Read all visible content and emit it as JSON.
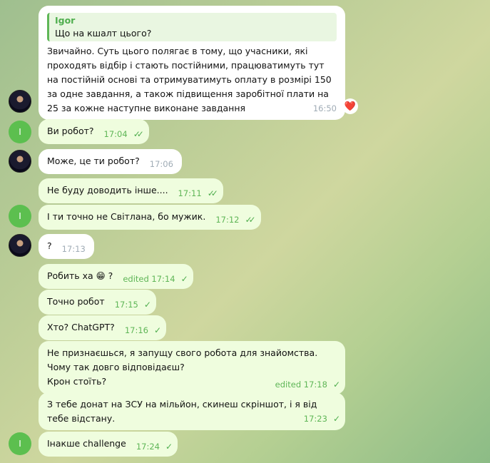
{
  "messages": [
    {
      "dir": "in",
      "quote_author": "Igor",
      "quote_text": "Що на кшалт цього?",
      "text": "Звичайно. Суть цього полягає в тому, що учасники, які проходять відбір і стають постійними, працюватимуть тут на постійній основі та отримуватимуть оплату в розмірі 150 за одне завдання, а також підвищення заробітної плати на 25 за кожне наступне виконане завдання",
      "time": "16:50",
      "reaction": "❤️"
    },
    {
      "dir": "out",
      "text": "Ви робот?",
      "time": "17:04",
      "status": "read"
    },
    {
      "dir": "in",
      "text": "Може, це ти робот?",
      "time": "17:06"
    },
    {
      "dir": "out",
      "text": "Не буду доводить інше....",
      "time": "17:11",
      "status": "read"
    },
    {
      "dir": "out",
      "text": "І  ти точно не Світлана, бо мужик.",
      "time": "17:12",
      "status": "read"
    },
    {
      "dir": "in",
      "text": "?",
      "time": "17:13"
    },
    {
      "dir": "out",
      "text": "Робить ха 😁 ?",
      "time": "edited 17:14",
      "status": "sent"
    },
    {
      "dir": "out",
      "text": "Точно робот",
      "time": "17:15",
      "status": "sent"
    },
    {
      "dir": "out",
      "text": "Хто? ChatGPT?",
      "time": "17:16",
      "status": "sent"
    },
    {
      "dir": "out",
      "text": "Не признаєшься, я запущу свого робота для знайомства. Чому так довго відповідаєш?\nКрон стоїть?",
      "time": "edited 17:18",
      "status": "sent"
    },
    {
      "dir": "out",
      "text": "З тебе донат на ЗСУ на мільйон, скинеш скріншот, і я від тебе відстану.",
      "time": "17:23",
      "status": "sent"
    },
    {
      "dir": "out",
      "text": "Інакше challenge",
      "time": "17:24",
      "status": "sent"
    }
  ],
  "avatar_initial": "I",
  "check_single": "✓",
  "check_double": "✓✓"
}
